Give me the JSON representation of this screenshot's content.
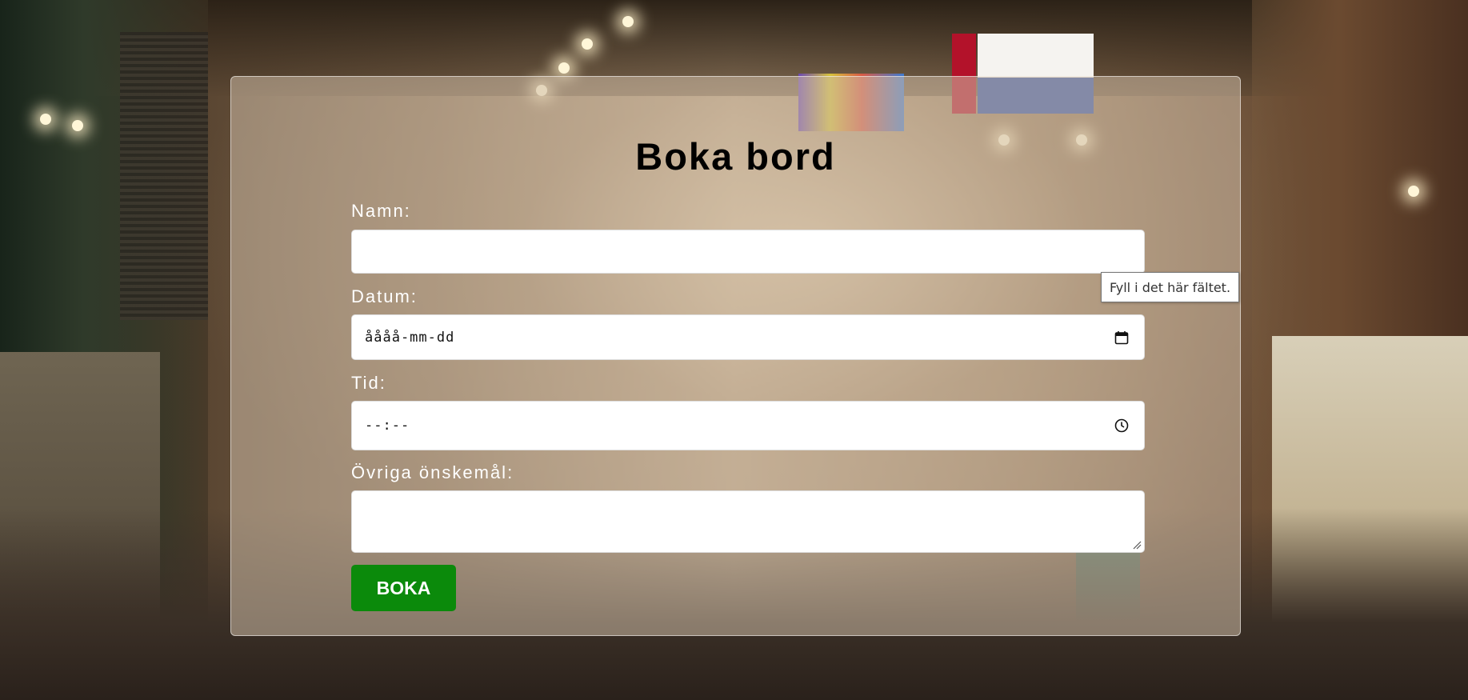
{
  "form": {
    "title": "Boka bord",
    "name_label": "Namn:",
    "name_value": "",
    "date_label": "Datum:",
    "date_placeholder": "åååå-mm-dd",
    "time_label": "Tid:",
    "time_placeholder": "--:--",
    "notes_label": "Övriga önskemål:",
    "notes_value": "",
    "submit_label": "BOKA"
  },
  "tooltip": {
    "text": "Fyll i det här fältet."
  },
  "icons": {
    "date": "calendar-icon",
    "time": "clock-icon",
    "resize": "resize-handle-icon"
  },
  "colors": {
    "submit_bg": "#0b8a0b",
    "title": "#000000",
    "labels": "#ffffff"
  }
}
